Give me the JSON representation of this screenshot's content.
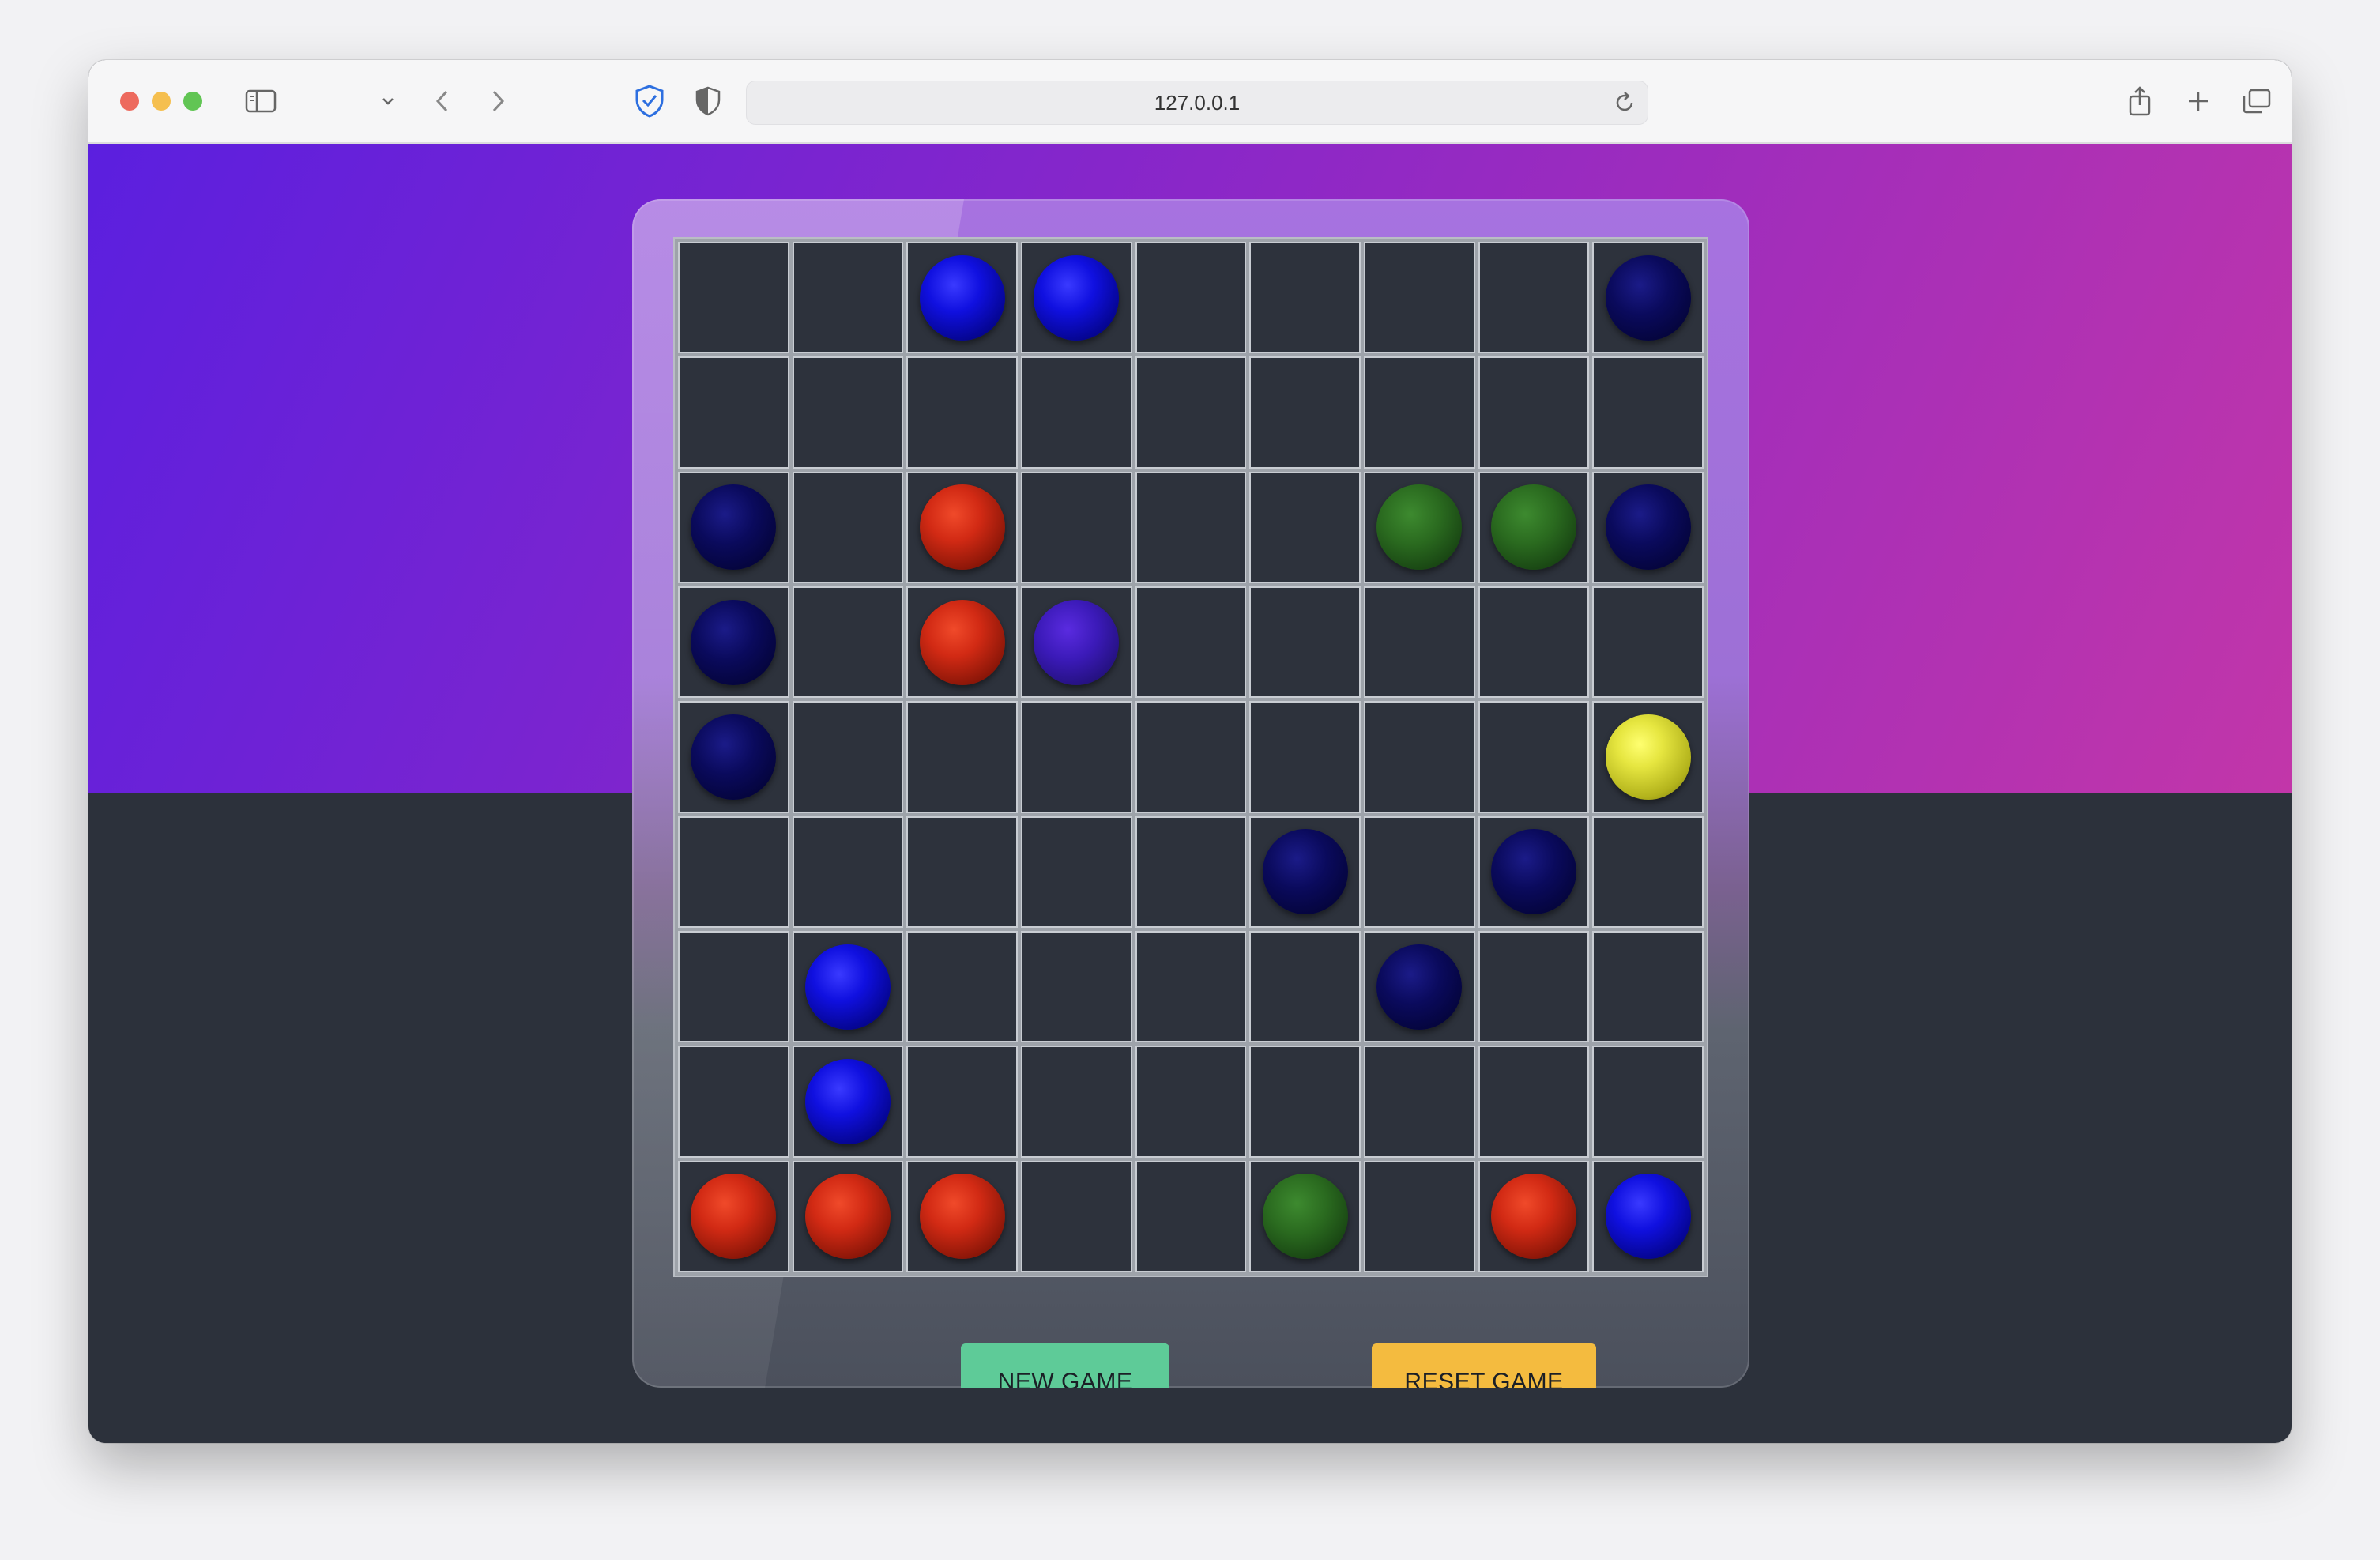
{
  "browser": {
    "url": "127.0.0.1"
  },
  "colors": {
    "blue": "#1010e0",
    "navy": "#0a0a5c",
    "red": "#d22a14",
    "green": "#2a6a1f",
    "purple": "#3b1ab8",
    "yellow": "#e6e640"
  },
  "board": {
    "rows": 9,
    "cols": 9,
    "cells": [
      [
        "",
        "",
        "blue",
        "blue",
        "",
        "",
        "",
        "",
        "navy"
      ],
      [
        "",
        "",
        "",
        "",
        "",
        "",
        "",
        "",
        ""
      ],
      [
        "navy",
        "",
        "red",
        "",
        "",
        "",
        "green",
        "green",
        "navy"
      ],
      [
        "navy",
        "",
        "red",
        "purple",
        "",
        "",
        "",
        "",
        ""
      ],
      [
        "navy",
        "",
        "",
        "",
        "",
        "",
        "",
        "",
        "yellow"
      ],
      [
        "",
        "",
        "",
        "",
        "",
        "navy",
        "",
        "navy",
        ""
      ],
      [
        "",
        "blue",
        "",
        "",
        "",
        "",
        "navy",
        "",
        ""
      ],
      [
        "",
        "blue",
        "",
        "",
        "",
        "",
        "",
        "",
        ""
      ],
      [
        "red",
        "red",
        "red",
        "",
        "",
        "green",
        "",
        "red",
        "blue"
      ]
    ]
  },
  "controls": {
    "new_game_label": "NEW GAME",
    "reset_game_label": "RESET GAME"
  }
}
